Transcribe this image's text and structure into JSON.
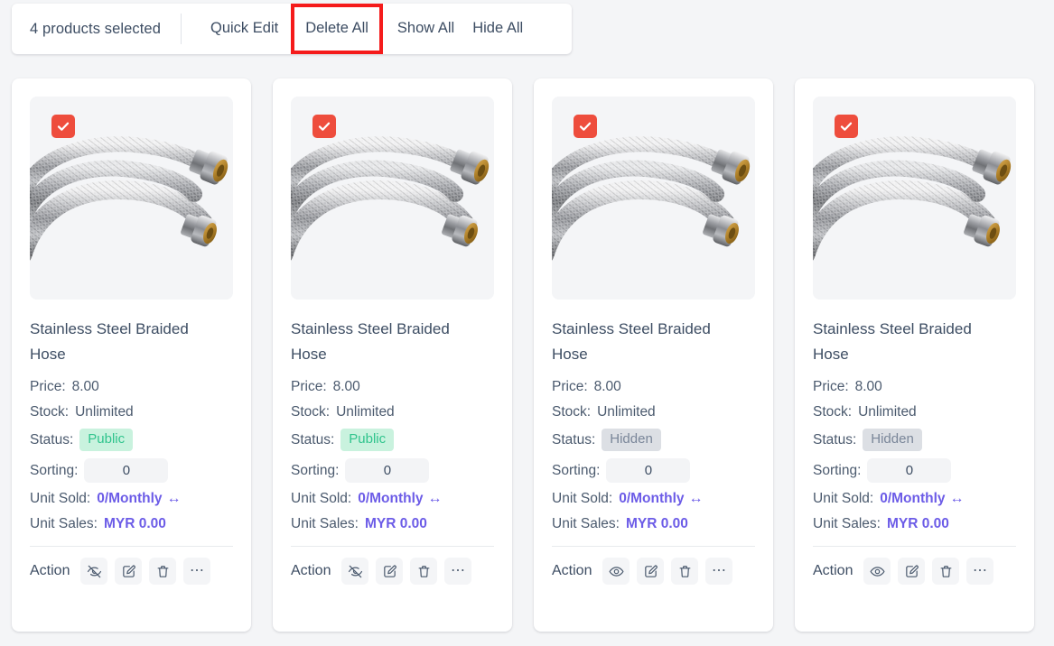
{
  "toolbar": {
    "selection_label": "4 products selected",
    "buttons": [
      {
        "label": "Quick Edit",
        "name": "quick-edit-button",
        "highlighted": false
      },
      {
        "label": "Delete All",
        "name": "delete-all-button",
        "highlighted": true
      },
      {
        "label": "Show All",
        "name": "show-all-button",
        "highlighted": false
      },
      {
        "label": "Hide All",
        "name": "hide-all-button",
        "highlighted": false
      }
    ],
    "highlight_color": "#f51b1b"
  },
  "labels": {
    "price": "Price:",
    "stock": "Stock:",
    "status": "Status:",
    "sorting": "Sorting:",
    "unit_sold": "Unit Sold:",
    "unit_sales": "Unit Sales:",
    "action": "Action"
  },
  "colors": {
    "checkbox": "#ee4d3d",
    "link": "#6c5ce7",
    "public_badge_bg": "#c9f2de",
    "public_badge_text": "#30c48d",
    "hidden_badge_bg": "#dcdfe4",
    "hidden_badge_text": "#7a8699"
  },
  "products": [
    {
      "title": "Stainless Steel Braided Hose",
      "price": "8.00",
      "stock": "Unlimited",
      "status": "Public",
      "sorting": "0",
      "unit_sold": "0/Monthly",
      "unit_sold_arrows": "↔",
      "unit_sales": "MYR 0.00",
      "selected": true,
      "visibility_icon": "eye-off-icon"
    },
    {
      "title": "Stainless Steel Braided Hose",
      "price": "8.00",
      "stock": "Unlimited",
      "status": "Public",
      "sorting": "0",
      "unit_sold": "0/Monthly",
      "unit_sold_arrows": "↔",
      "unit_sales": "MYR 0.00",
      "selected": true,
      "visibility_icon": "eye-off-icon"
    },
    {
      "title": "Stainless Steel Braided Hose",
      "price": "8.00",
      "stock": "Unlimited",
      "status": "Hidden",
      "sorting": "0",
      "unit_sold": "0/Monthly",
      "unit_sold_arrows": "↔",
      "unit_sales": "MYR 0.00",
      "selected": true,
      "visibility_icon": "eye-icon"
    },
    {
      "title": "Stainless Steel Braided Hose",
      "price": "8.00",
      "stock": "Unlimited",
      "status": "Hidden",
      "sorting": "0",
      "unit_sold": "0/Monthly",
      "unit_sold_arrows": "↔",
      "unit_sales": "MYR 0.00",
      "selected": true,
      "visibility_icon": "eye-icon"
    }
  ]
}
